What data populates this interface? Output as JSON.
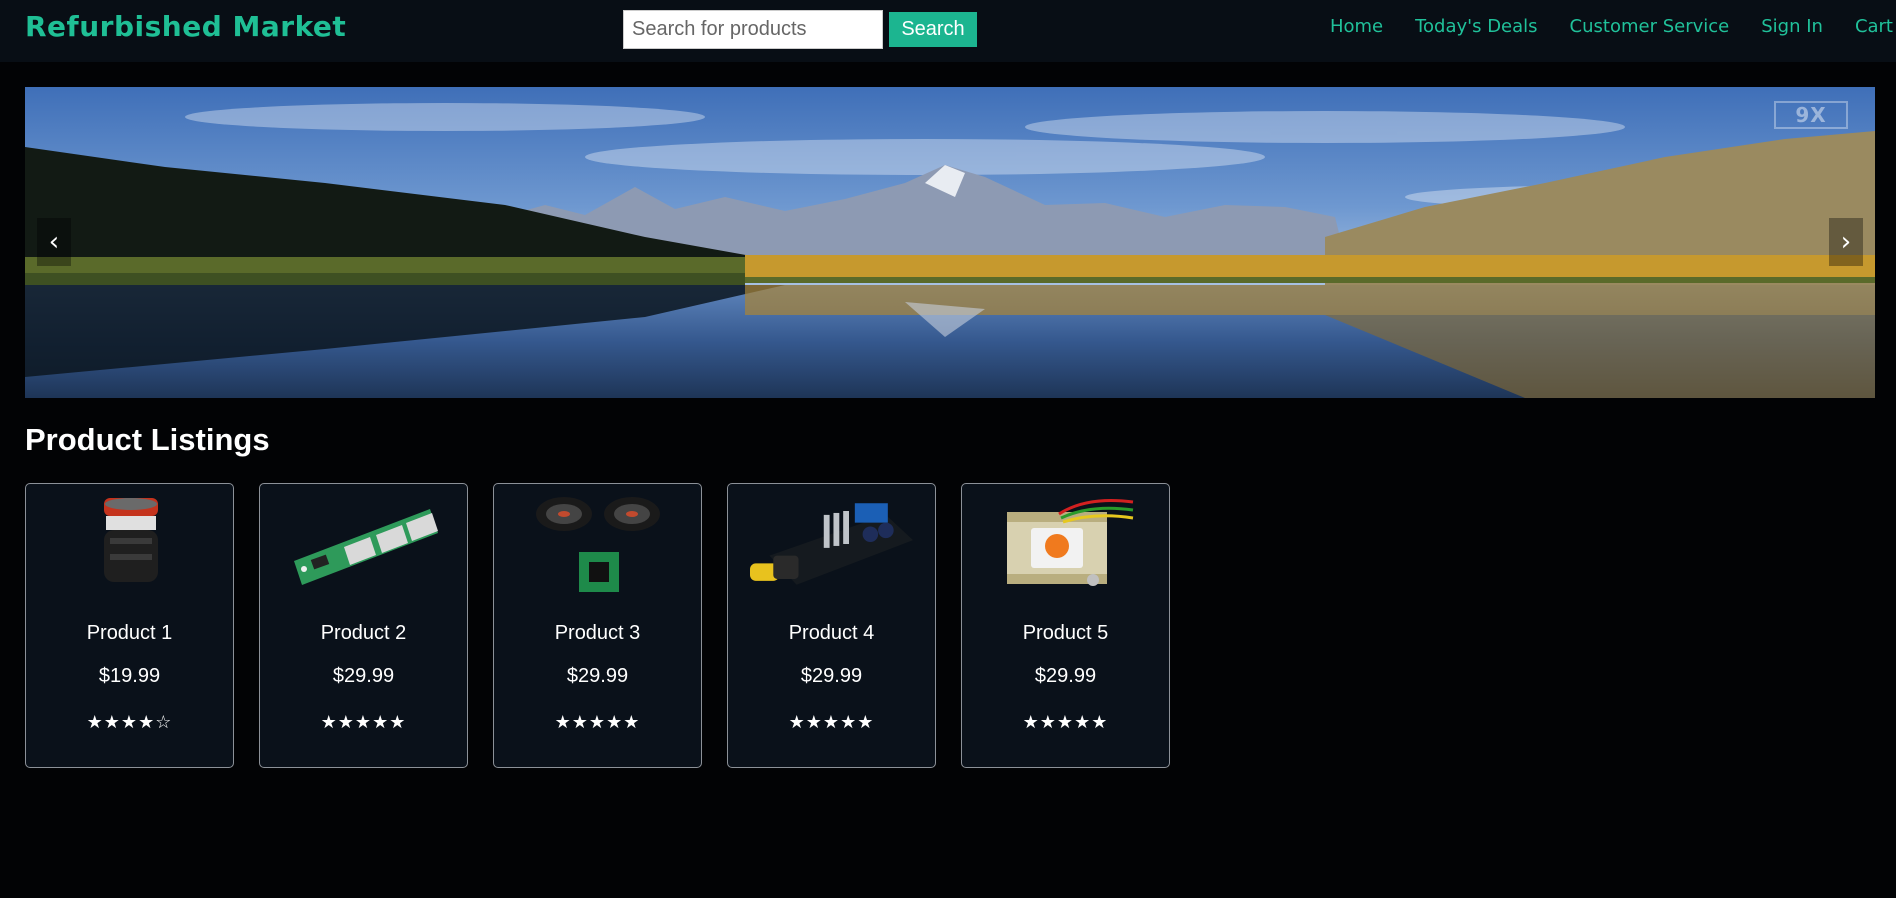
{
  "brand": {
    "name": "Refurbished Market"
  },
  "search": {
    "placeholder": "Search for products",
    "value": "",
    "button_label": "Search"
  },
  "nav": {
    "links": [
      "Home",
      "Today's Deals",
      "Customer Service",
      "Sign In",
      "Cart"
    ]
  },
  "carousel": {
    "prev_label": "‹",
    "next_label": "›",
    "watermark": "9X"
  },
  "listings": {
    "title": "Product Listings",
    "products": [
      {
        "name": "Product 1",
        "price": "$19.99",
        "rating": "★★★★☆",
        "image_icon": "microphone-capsule-icon"
      },
      {
        "name": "Product 2",
        "price": "$29.99",
        "rating": "★★★★★",
        "image_icon": "usb-board-icon"
      },
      {
        "name": "Product 3",
        "price": "$29.99",
        "rating": "★★★★★",
        "image_icon": "speakers-amplifier-icon"
      },
      {
        "name": "Product 4",
        "price": "$29.99",
        "rating": "★★★★★",
        "image_icon": "motor-controller-icon"
      },
      {
        "name": "Product 5",
        "price": "$29.99",
        "rating": "★★★★★",
        "image_icon": "transformer-icon"
      }
    ]
  },
  "colors": {
    "accent": "#1fbf95",
    "nav_bg": "#080e15",
    "page_bg": "#020305",
    "card_bg": "#0a111a",
    "card_border": "#8c9198"
  }
}
